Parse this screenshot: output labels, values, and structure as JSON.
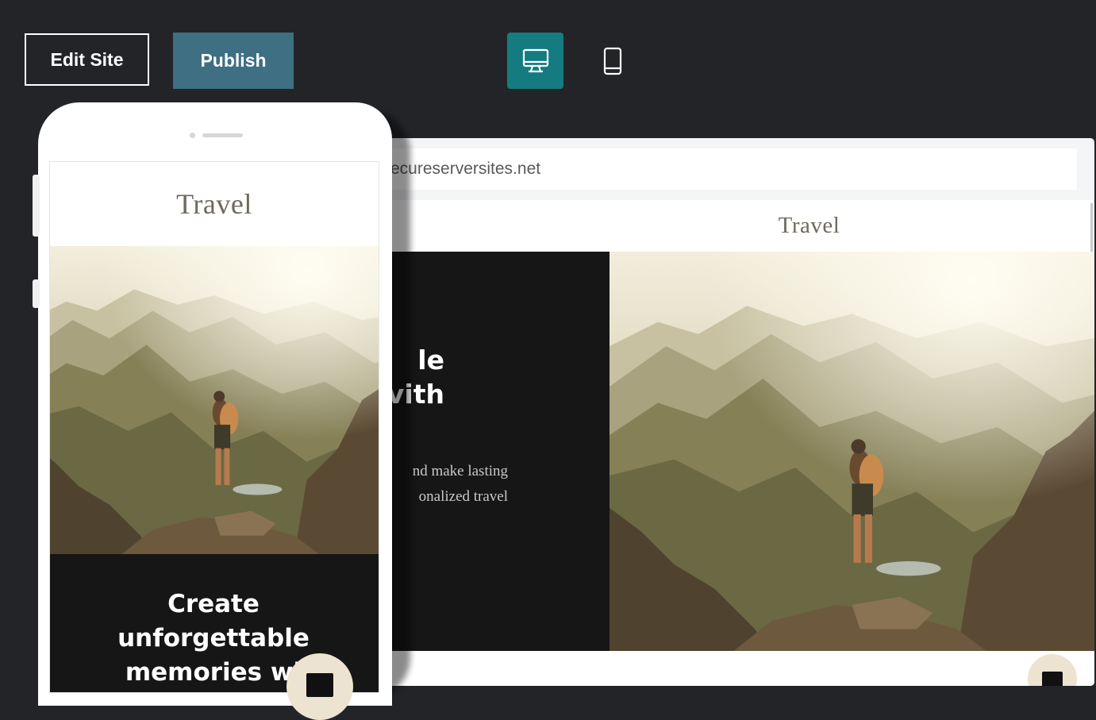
{
  "toolbar": {
    "edit_label": "Edit Site",
    "publish_label": "Publish",
    "desktop_view_icon": "desktop-monitor-icon",
    "mobile_view_icon": "smartphone-icon",
    "active_view": "desktop",
    "accent_color": "#147c80",
    "publish_color": "#3e6f82"
  },
  "desktop_preview": {
    "url": "ecureserversites.net",
    "site_title": "Travel",
    "hero_heading_lines": [
      "le",
      "vith"
    ],
    "hero_body_lines": [
      "nd make lasting",
      "onalized travel"
    ],
    "chat_icon": "chat-bubble-icon"
  },
  "mobile_preview": {
    "site_title": "Travel",
    "hero_heading_lines": [
      "Create",
      "unforgettable",
      "memories wi"
    ],
    "chat_icon": "chat-bubble-icon"
  }
}
